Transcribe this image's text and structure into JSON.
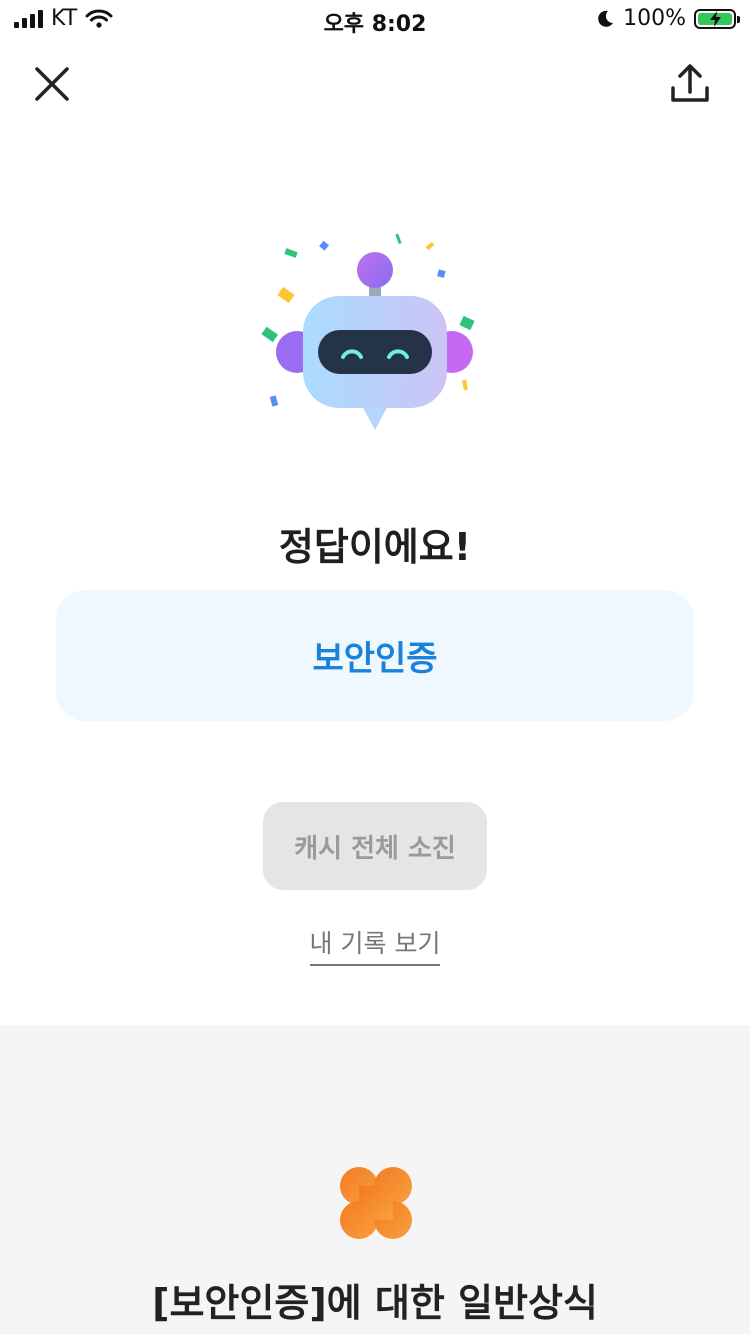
{
  "status_bar": {
    "carrier": "KT",
    "time": "오후 8:02",
    "battery_percent": "100%",
    "battery_level": 1.0,
    "charging": true
  },
  "nav": {
    "close_icon": "close-icon",
    "share_icon": "share-icon"
  },
  "result": {
    "title": "정답이에요!",
    "answer": "보안인증"
  },
  "actions": {
    "cash_button": "캐시 전체 소진",
    "history_link": "내 기록 보기"
  },
  "info": {
    "title": "[보안인증]에 대한 일반상식"
  },
  "colors": {
    "answer_card_bg": "#eff7ff",
    "answer_text": "#1a82d8",
    "disabled_button_bg": "#e5e5e5",
    "section_bg": "#f5f5f5",
    "clover": "#f58a2c"
  }
}
